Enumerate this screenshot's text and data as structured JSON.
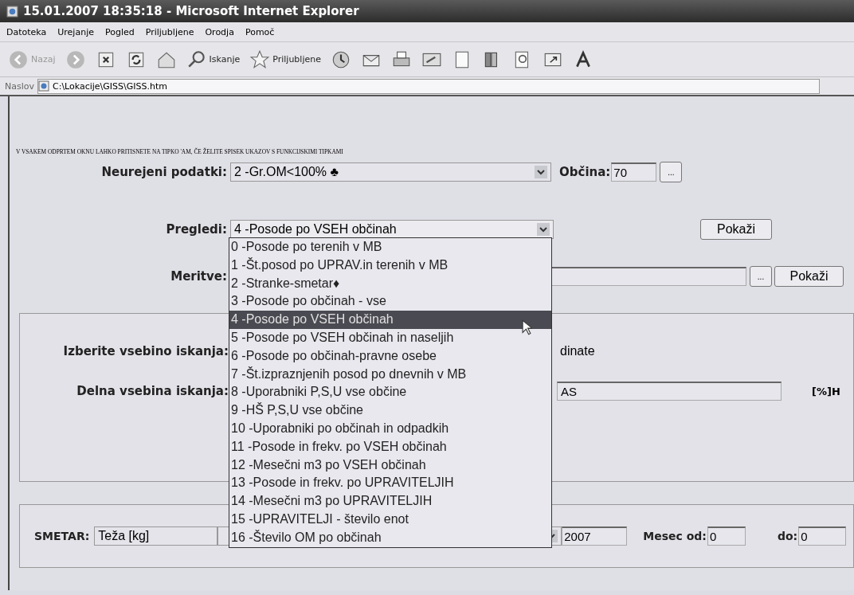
{
  "window": {
    "title": "15.01.2007 18:35:18 - Microsoft Internet Explorer"
  },
  "menu": [
    "Datoteka",
    "Urejanje",
    "Pogled",
    "Priljubljene",
    "Orodja",
    "Pomoč"
  ],
  "toolbar": [
    {
      "kind": "back",
      "label": "Nazaj",
      "disabled": true
    },
    {
      "kind": "forward",
      "disabled": true
    },
    {
      "kind": "stop"
    },
    {
      "kind": "refresh"
    },
    {
      "kind": "home"
    },
    {
      "kind": "search",
      "label": "Iskanje"
    },
    {
      "kind": "favorites",
      "label": "Priljubljene"
    },
    {
      "kind": "history"
    },
    {
      "kind": "mail"
    },
    {
      "kind": "print"
    },
    {
      "kind": "edit"
    },
    {
      "kind": "page"
    },
    {
      "kind": "research"
    },
    {
      "kind": "find"
    },
    {
      "kind": "window"
    },
    {
      "kind": "font"
    }
  ],
  "address": {
    "label": "Naslov",
    "value": "C:\\Lokacije\\GISS\\GISS.htm"
  },
  "form": {
    "hint": "V VSAKEM ODPRTEM OKNU LAHKO PRITISNETE NA TIPKO 'AM, ČE ŽELITE SPISEK UKAZOV S FUNKCIJSKIMI TIPKAMI",
    "neurejeni": {
      "label": "Neurejeni podatki:",
      "value": "2 -Gr.OM<100% ♣"
    },
    "obcina": {
      "label": "Občina:",
      "value": "70",
      "browse": "..."
    },
    "pregledi": {
      "label": "Pregledi:",
      "value": "4 -Posode po VSEH občinah",
      "button": "Pokaži"
    },
    "meritve": {
      "label": "Meritve:",
      "browse": "...",
      "button": "Pokaži"
    },
    "izberite": {
      "label": "Izberite vsebino iskanja:",
      "option_text": "dinate"
    },
    "delna": {
      "label": "Delna vsebina iskanja:",
      "value": "AS",
      "suffix": "[%]H"
    },
    "smetar": {
      "label": "SMETAR:",
      "unit": "Teža [kg]",
      "year": "2007",
      "month_from_label": "Mesec od:",
      "month_from": "0",
      "month_to_label": "do:",
      "month_to": "0"
    }
  },
  "dropdown": [
    {
      "label": "0 -Posode po terenih v MB",
      "selected": false
    },
    {
      "label": "1 -Št.posod po UPRAV.in terenih v MB",
      "selected": false
    },
    {
      "label": "2 -Stranke-smetar♦",
      "selected": false
    },
    {
      "label": "3 -Posode po občinah - vse",
      "selected": false
    },
    {
      "label": "4 -Posode po VSEH občinah",
      "selected": true
    },
    {
      "label": "5 -Posode po VSEH občinah in naseljih",
      "selected": false
    },
    {
      "label": "6 -Posode po občinah-pravne osebe",
      "selected": false
    },
    {
      "label": "7 -Št.izpraznjenih posod po dnevnih v MB",
      "selected": false
    },
    {
      "label": "8 -Uporabniki P,S,U vse občine",
      "selected": false
    },
    {
      "label": "9 -HŠ P,S,U vse občine",
      "selected": false
    },
    {
      "label": "10 -Uporabniki po občinah in odpadkih",
      "selected": false
    },
    {
      "label": "11 -Posode in frekv. po VSEH občinah",
      "selected": false
    },
    {
      "label": "12 -Mesečni m3 po VSEH občinah",
      "selected": false
    },
    {
      "label": "13 -Posode in frekv. po UPRAVITELJIH",
      "selected": false
    },
    {
      "label": "14 -Mesečni m3 po UPRAVITELJIH",
      "selected": false
    },
    {
      "label": "15 -UPRAVITELJI - število enot",
      "selected": false
    },
    {
      "label": "16 -Število OM po občinah",
      "selected": false
    }
  ]
}
